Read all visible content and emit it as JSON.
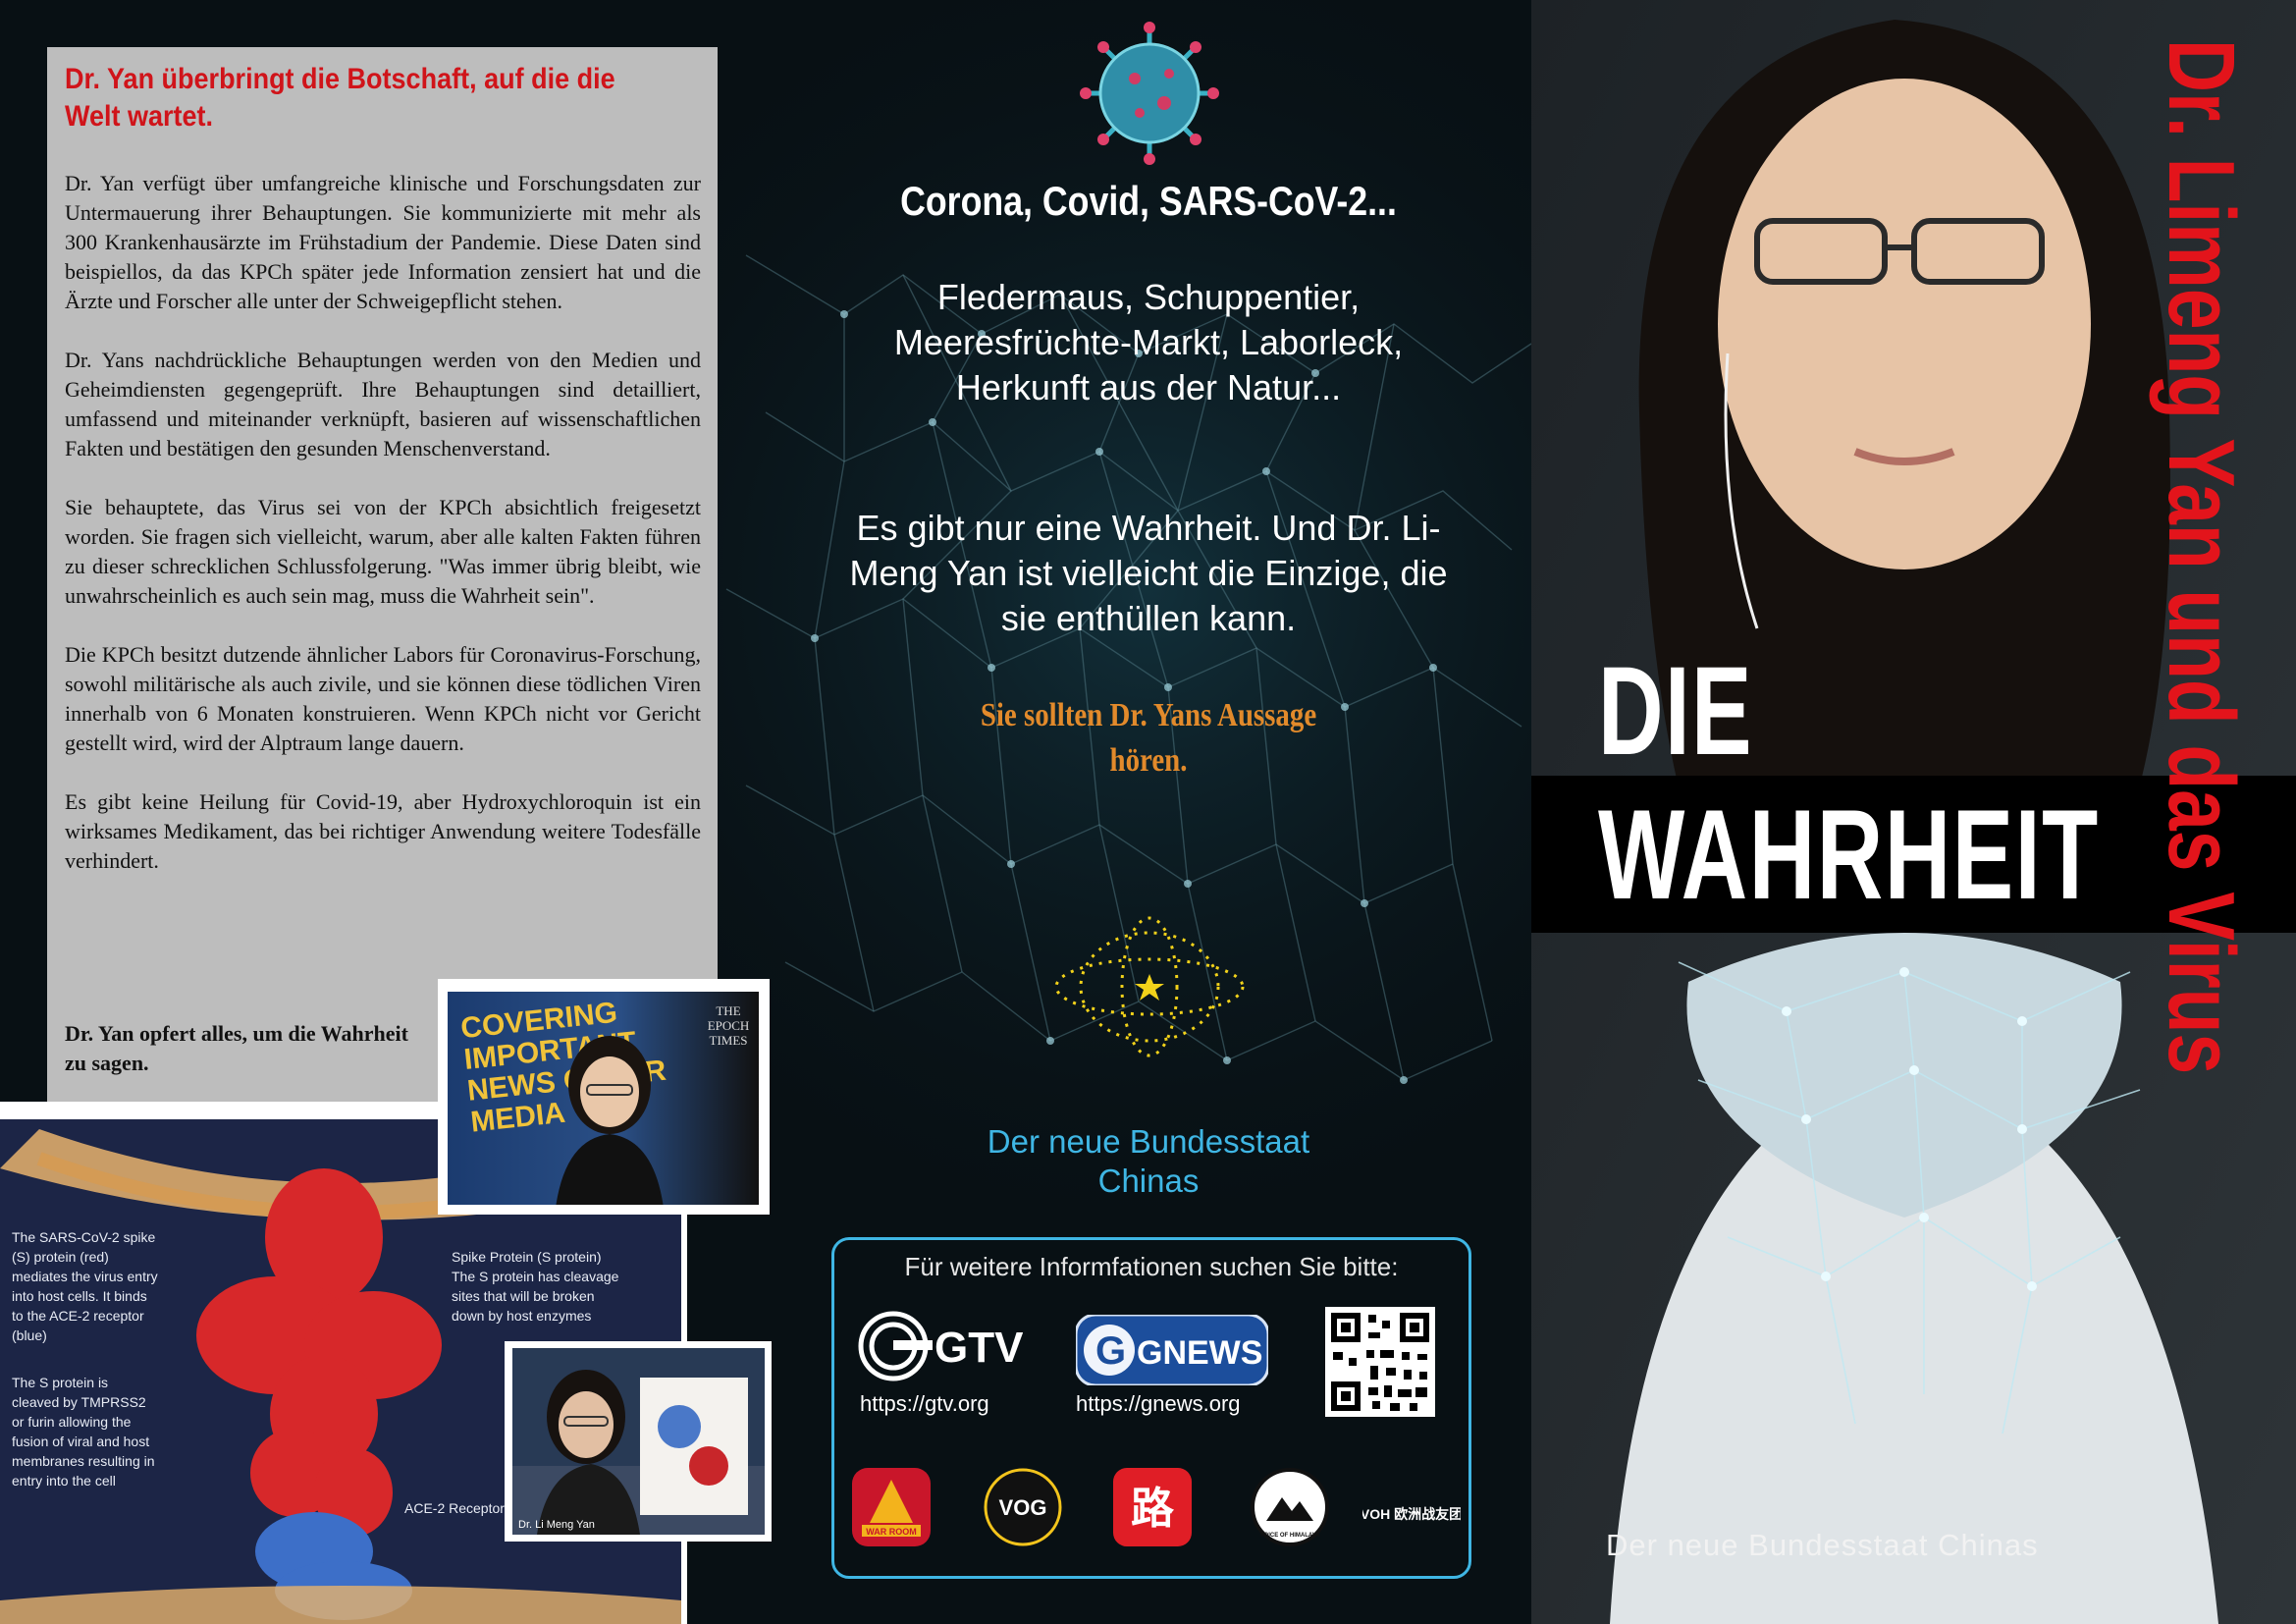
{
  "left": {
    "title": "Dr. Yan überbringt die Botschaft, auf die die Welt wartet.",
    "paragraphs": [
      "Dr. Yan verfügt über umfangreiche klinische und Forschungsdaten zur Untermauerung ihrer Behauptungen. Sie kommunizierte mit mehr als 300 Krankenhausärzte im Frühstadium der Pandemie. Diese Daten sind beispiellos, da das KPCh später jede Information zensiert hat und die Ärzte und Forscher alle unter der Schweigepflicht stehen.",
      "Dr. Yans nachdrückliche Behauptungen werden von den Medien und Geheimdiensten gegengeprüft. Ihre Behauptungen sind detailliert, umfassend und miteinander verknüpft, basieren auf wissenschaftlichen Fakten und bestätigen den gesunden Menschenverstand.",
      "Sie behauptete, das Virus sei von der KPCh absichtlich freigesetzt worden. Sie fragen sich vielleicht, warum, aber alle kalten Fakten führen zu dieser schrecklichen Schlussfolgerung. \"Was immer übrig bleibt, wie unwahrscheinlich es auch sein mag, muss die Wahrheit sein\".",
      "Die KPCh besitzt dutzende ähnlicher Labors für Coronavirus-Forschung, sowohl militärische als auch zivile, und sie können diese tödlichen Viren innerhalb von 6 Monaten konstruieren. Wenn KPCh nicht vor Gericht gestellt wird, wird der Alptraum lange dauern.",
      "Es gibt keine Heilung für Covid-19, aber Hydroxychloroquin ist ein wirksames Medikament, das bei richtiger Anwendung weitere Todesfälle verhindert."
    ],
    "closing": "Dr. Yan opfert alles, um die Wahrheit zu sagen."
  },
  "insets": {
    "banner": "COVERING IMPORTANT NEWS OTHER MEDIA",
    "epoch": "THE EPOCH TIMES",
    "spike_left_1": "The SARS-CoV-2 spike (S) protein (red) mediates the virus entry into host cells. It binds to the ACE-2 receptor (blue)",
    "spike_left_2": "The S protein is cleaved by TMPRSS2 or furin allowing the fusion of viral and host membranes resulting in entry into the cell",
    "spike_right": "Spike Protein (S protein) The S protein has cleavage sites that will be broken down by host enzymes",
    "ace2": "ACE-2 Receptor",
    "video_caption": "Dr. Li Meng Yan"
  },
  "middle": {
    "title": "Corona, Covid, SARS-CoV-2...",
    "p1": "Fledermaus, Schuppentier, Meeresfrüchte-Markt, Laborleck, Herkunft aus der Natur...",
    "p2": "Es gibt nur eine Wahrheit. Und Dr. Li-Meng Yan ist vielleicht die Einzige, die sie enthüllen kann.",
    "cta": "Sie sollten Dr. Yans Aussage hören.",
    "org": "Der neue Bundesstaat Chinas"
  },
  "info": {
    "heading": "Für weitere Informfationen suchen Sie bitte:",
    "gtv_url": "https://gtv.org",
    "gnews_url": "https://gnews.org",
    "gtv_logo": "GTV",
    "gnews_logo": "GNEWS",
    "apps": [
      "WAR ROOM",
      "VOG",
      "路",
      "VOICE OF HIMALAYA",
      "VOH 欧洲战友团"
    ]
  },
  "right": {
    "die": "DIE",
    "wahrheit": "WAHRHEIT",
    "vertical": "Dr. Limeng Yan und das Virus",
    "org": "Der neue Bundesstaat Chinas"
  },
  "colors": {
    "red": "#e3141b",
    "orange": "#e28a2b",
    "cyan": "#3fb6e4",
    "panel_gray": "#bdbdbd"
  }
}
